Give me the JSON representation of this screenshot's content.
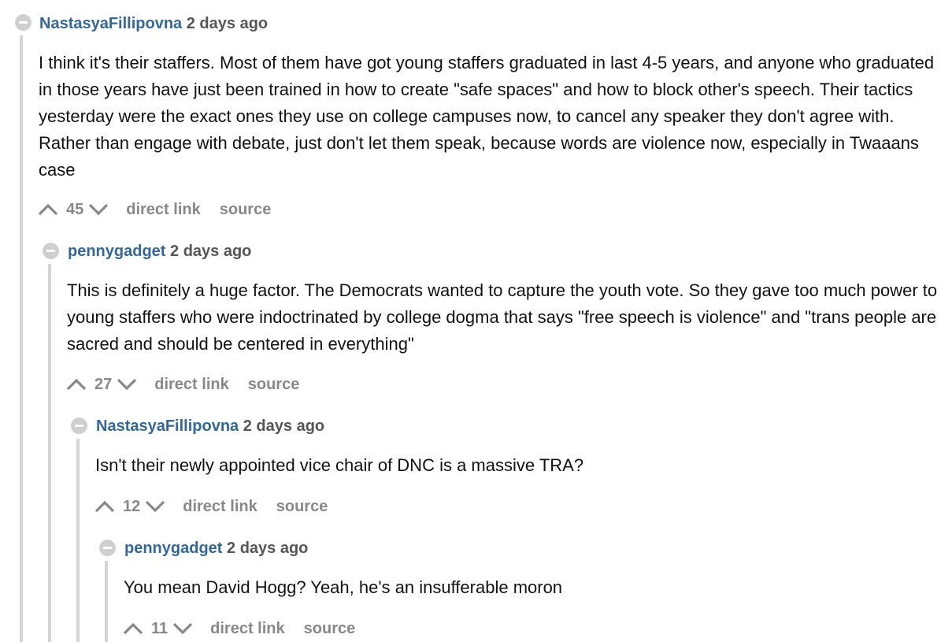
{
  "comments": [
    {
      "author": "NastasyaFillipovna",
      "time": "2 days ago",
      "body": "I think it's their staffers. Most of them have got young staffers graduated in last 4-5 years, and anyone who graduated in those years have just been trained in how to create \"safe spaces\" and how to block other's speech. Their tactics yesterday were the exact ones they use on college campuses now, to cancel any speaker they don't agree with. Rather than engage with debate, just don't let them speak, because words are violence now, especially in Twaaans case",
      "score": "45",
      "direct_link": "direct link",
      "source": "source"
    },
    {
      "author": "pennygadget",
      "time": "2 days ago",
      "body": "This is definitely a huge factor. The Democrats wanted to capture the youth vote. So they gave too much power to young staffers who were indoctrinated by college dogma that says \"free speech is violence\" and \"trans people are sacred and should be centered in everything\"",
      "score": "27",
      "direct_link": "direct link",
      "source": "source"
    },
    {
      "author": "NastasyaFillipovna",
      "time": "2 days ago",
      "body": "Isn't their newly appointed vice chair of DNC is a massive TRA?",
      "score": "12",
      "direct_link": "direct link",
      "source": "source"
    },
    {
      "author": "pennygadget",
      "time": "2 days ago",
      "body": "You mean David Hogg? Yeah, he's an insufferable moron",
      "score": "11",
      "direct_link": "direct link",
      "source": "source"
    }
  ],
  "icons": {
    "collapse": "collapse-icon",
    "upvote": "upvote-chevron-icon",
    "downvote": "downvote-chevron-icon"
  },
  "colors": {
    "author_link": "#336699",
    "meta_gray": "#888888",
    "thread_line": "#d4d4d4"
  }
}
